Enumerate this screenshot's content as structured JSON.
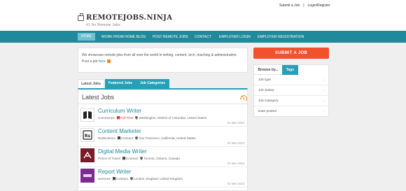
{
  "header": {
    "logo_text": "REMOTEJOBS.NINJA",
    "logo_tagline": "#1 for Remote Jobs",
    "submit_link": "Submit a Job",
    "login_link": "Login/Register",
    "separator": "|"
  },
  "nav": {
    "items": [
      "HOME",
      "WORK FROM HOME BLOG",
      "POST REMOTE JOBS",
      "CONTACT",
      "EMPLOYER LOGIN",
      "EMPLOYER REGISTRATION"
    ]
  },
  "intro": {
    "text": "We showcase remote jobs from all over the world in writing, content, tech, teaching & administration. Post a job ",
    "link": "here"
  },
  "tabs": [
    "Latest Jobs",
    "Featured Jobs",
    "Job Categories"
  ],
  "jobs_panel": {
    "title": "Latest Jobs",
    "jobs": [
      {
        "title": "Curriculum Writer",
        "company": "CommonLit",
        "type": "Full-Time",
        "location": "Washington, District of Columbia, United States",
        "date": "01 Mar 2023"
      },
      {
        "title": "Content Marketer",
        "company": "RedScience",
        "type": "Contract",
        "location": "San Francisco, California, United States",
        "date": "01 Mar 2023"
      },
      {
        "title": "Digital Media Writer",
        "company": "Prince of Travel",
        "type": "Contract",
        "location": "Toronto, Ontario, Canada",
        "date": "01 Mar 2023"
      },
      {
        "title": "Report Writer",
        "company": "Services",
        "type": "Contract",
        "location": "London, England, United Kingdom",
        "date": "01 Mar 2023"
      }
    ]
  },
  "sidebar": {
    "submit_button": "SUBMIT A JOB",
    "browse_tab": "Browse by...",
    "tags_tab": "Tags",
    "filters": [
      "Job type",
      "Job Salary",
      "Job Category",
      "Date posted"
    ],
    "chevron": "›"
  },
  "colors": {
    "primary": "#1f8a9c",
    "accent": "#f2512d",
    "rss": "#f0861a"
  },
  "icons": {
    "logo": "briefcase-icon",
    "rss": "rss-icon",
    "job_type": "bookmark-icon",
    "location": "map-pin-icon"
  }
}
